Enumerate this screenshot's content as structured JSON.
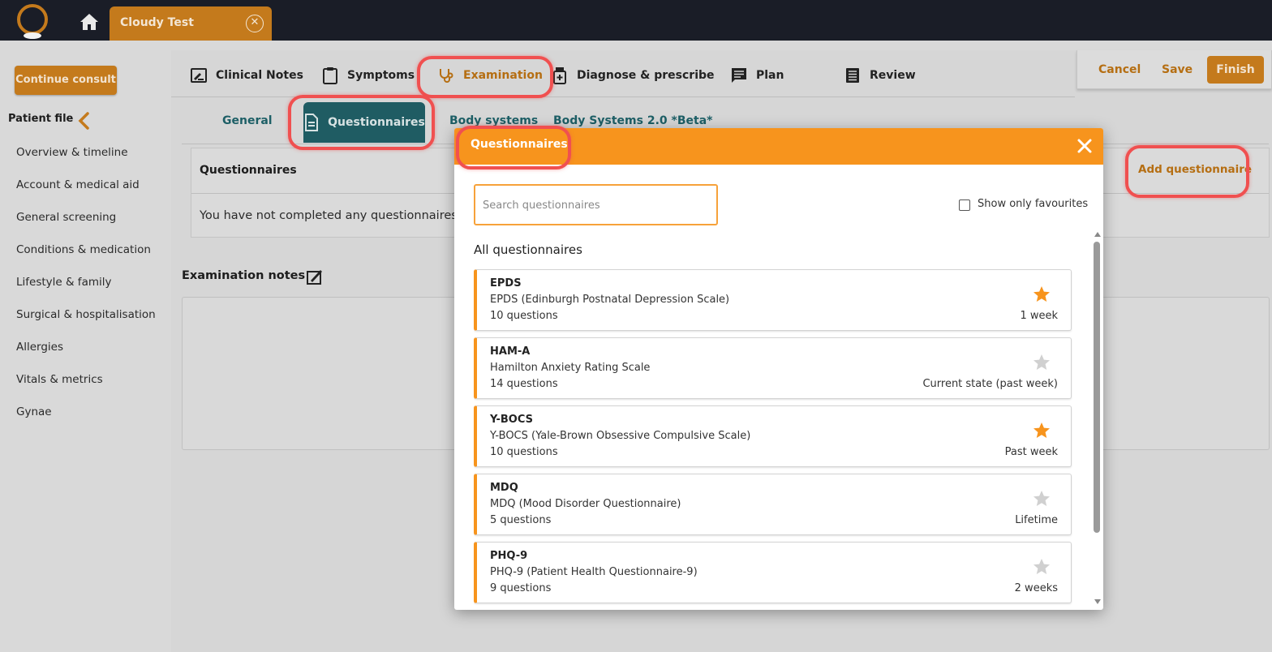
{
  "topbar": {
    "patient_tab_label": "Cloudy Test",
    "close_glyph": "✕"
  },
  "sidebar": {
    "continue_label": "Continue consult",
    "patient_file_label": "Patient file",
    "items": [
      {
        "label": "Overview & timeline"
      },
      {
        "label": "Account & medical aid"
      },
      {
        "label": "General screening"
      },
      {
        "label": "Conditions & medication"
      },
      {
        "label": "Lifestyle & family"
      },
      {
        "label": "Surgical & hospitalisation"
      },
      {
        "label": "Allergies"
      },
      {
        "label": "Vitals & metrics"
      },
      {
        "label": "Gynae"
      }
    ]
  },
  "main": {
    "tabs": [
      {
        "label": "Clinical Notes",
        "icon": "edit-note-icon"
      },
      {
        "label": "Symptoms",
        "icon": "clipboard-icon"
      },
      {
        "label": "Examination",
        "icon": "stethoscope-icon",
        "active": true
      },
      {
        "label": "Diagnose & prescribe",
        "icon": "medicine-bottle-icon"
      },
      {
        "label": "Plan",
        "icon": "chat-note-icon"
      },
      {
        "label": "Review",
        "icon": "list-icon"
      }
    ],
    "actions": {
      "cancel": "Cancel",
      "save": "Save",
      "finish": "Finish"
    },
    "sub_tabs": [
      {
        "label": "General"
      },
      {
        "label": "Questionnaires",
        "active": true
      },
      {
        "label": "Body systems"
      },
      {
        "label": "Body Systems 2.0 *Beta*"
      }
    ],
    "questionnaires_card": {
      "title": "Questionnaires",
      "empty_text": "You have not completed any questionnaires",
      "add_label": "Add questionnaire"
    },
    "exam_notes_label": "Examination notes"
  },
  "modal": {
    "title": "Questionnaires",
    "search_placeholder": "Search questionnaires",
    "favourites_label": "Show only favourites",
    "all_label": "All questionnaires",
    "items": [
      {
        "code": "EPDS",
        "name": "EPDS (Edinburgh Postnatal Depression Scale)",
        "count": "10 questions",
        "period": "1 week",
        "favourite": true
      },
      {
        "code": "HAM-A",
        "name": "Hamilton Anxiety Rating Scale",
        "count": "14 questions",
        "period": "Current state (past week)",
        "favourite": false
      },
      {
        "code": "Y-BOCS",
        "name": "Y-BOCS (Yale-Brown Obsessive Compulsive Scale)",
        "count": "10 questions",
        "period": "Past week",
        "favourite": true
      },
      {
        "code": "MDQ",
        "name": "MDQ (Mood Disorder Questionnaire)",
        "count": "5 questions",
        "period": "Lifetime",
        "favourite": false
      },
      {
        "code": "PHQ-9",
        "name": "PHQ-9 (Patient Health Questionnaire-9)",
        "count": "9 questions",
        "period": "2 weeks",
        "favourite": false
      }
    ]
  },
  "colors": {
    "accent": "#f7941d",
    "brand_dark": "#c47a1c",
    "teal": "#1f5c63",
    "highlight": "#f05050",
    "star_on": "#f7941d",
    "star_off": "#d0d0d0"
  }
}
